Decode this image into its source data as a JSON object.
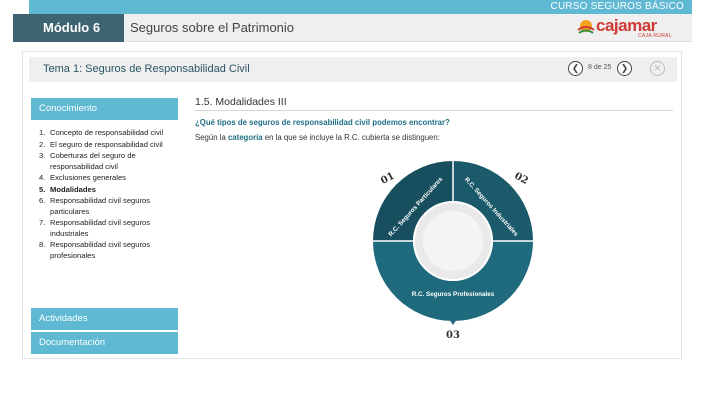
{
  "course": {
    "title": "CURSO SEGUROS BÁSICO"
  },
  "header": {
    "module": "Módulo 6",
    "subject": "Seguros sobre el Patrimonio",
    "brand": {
      "name": "cajamar",
      "sub": "CAJA RURAL"
    }
  },
  "topic": {
    "title": "Tema 1: Seguros de Responsabilidad Civil",
    "page_count": "8 de 25"
  },
  "sidebar": {
    "knowledge_label": "Conocimiento",
    "activities_label": "Actividades",
    "documentation_label": "Documentación",
    "items": [
      {
        "num": "1.",
        "label": "Concepto de responsabilidad civil",
        "active": false
      },
      {
        "num": "2.",
        "label": "El seguro de responsabilidad civil",
        "active": false
      },
      {
        "num": "3.",
        "label": "Coberturas del seguro de responsabilidad civil",
        "active": false
      },
      {
        "num": "4.",
        "label": "Exclusiones generales",
        "active": false
      },
      {
        "num": "5.",
        "label": "Modalidades",
        "active": true
      },
      {
        "num": "6.",
        "label": "Responsabilidad civil seguros particulares",
        "active": false
      },
      {
        "num": "7.",
        "label": "Responsabilidad civil seguros industriales",
        "active": false
      },
      {
        "num": "8.",
        "label": "Responsabilidad civil seguros profesionales",
        "active": false
      }
    ]
  },
  "content": {
    "section_title": "1.5. Modalidades III",
    "question": "¿Qué tipos de seguros de responsabilidad civil podemos encontrar?",
    "intro_before": "Según la ",
    "intro_keyword": "categoría",
    "intro_after": " en la que se incluye la R.C. cubierta se distinguen:"
  },
  "diagram": {
    "segments": [
      {
        "number": "01",
        "label": "R.C. Seguros Particulares"
      },
      {
        "number": "02",
        "label": "R.C. Seguros Industriales"
      },
      {
        "number": "03",
        "label": "R.C. Seguros Profesionales"
      }
    ],
    "colors": {
      "ring": "#1f6a7d",
      "ring_dark": "#174f5e",
      "divider": "#ffffff",
      "number": "#333333"
    }
  }
}
